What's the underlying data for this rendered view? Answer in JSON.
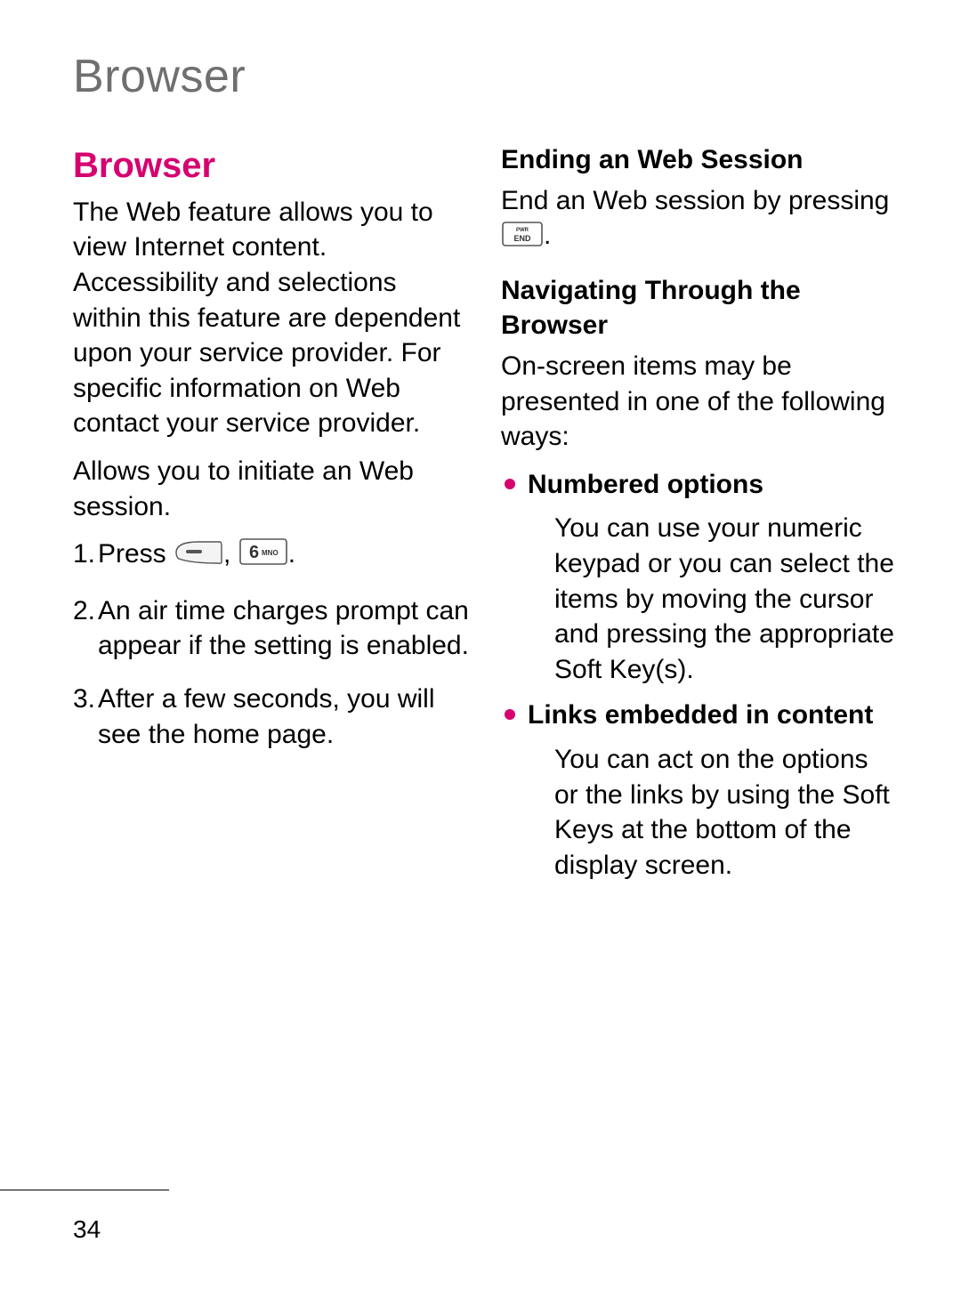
{
  "chapter": "Browser",
  "page_number": "34",
  "left": {
    "heading": "Browser",
    "intro": "The Web feature allows you to view Internet content. Accessibility and selections within this feature are dependent upon your service provider. For specific information on Web contact your service provider.",
    "para2": "Allows you to initiate an Web session.",
    "steps": {
      "s1_num": "1.",
      "s1_a": "Press ",
      "s1_comma": ", ",
      "s1_dot": ".",
      "s2_num": "2.",
      "s2": "An air time charges prompt can appear if the setting is enabled.",
      "s3_num": "3.",
      "s3": "After a few seconds, you will see the home page."
    }
  },
  "right": {
    "h_end": "Ending an Web Session",
    "end_a": "End an Web session by pressing ",
    "end_dot": ".",
    "h_nav": "Navigating Through the Browser",
    "nav_intro": "On-screen items may be presented in one of the following ways:",
    "bullets": {
      "b1_title": "Numbered options",
      "b1_body": "You can use your numeric keypad or you can select the items by moving the cursor and pressing the appropriate Soft Key(s).",
      "b2_title": "Links embedded in content",
      "b2_body": "You can act on the options or the links by using the Soft Keys at the bottom of the display screen."
    }
  },
  "icons": {
    "softkey": "left-softkey-icon",
    "six": "6-mno-key-icon",
    "end": "pwr-end-key-icon"
  }
}
